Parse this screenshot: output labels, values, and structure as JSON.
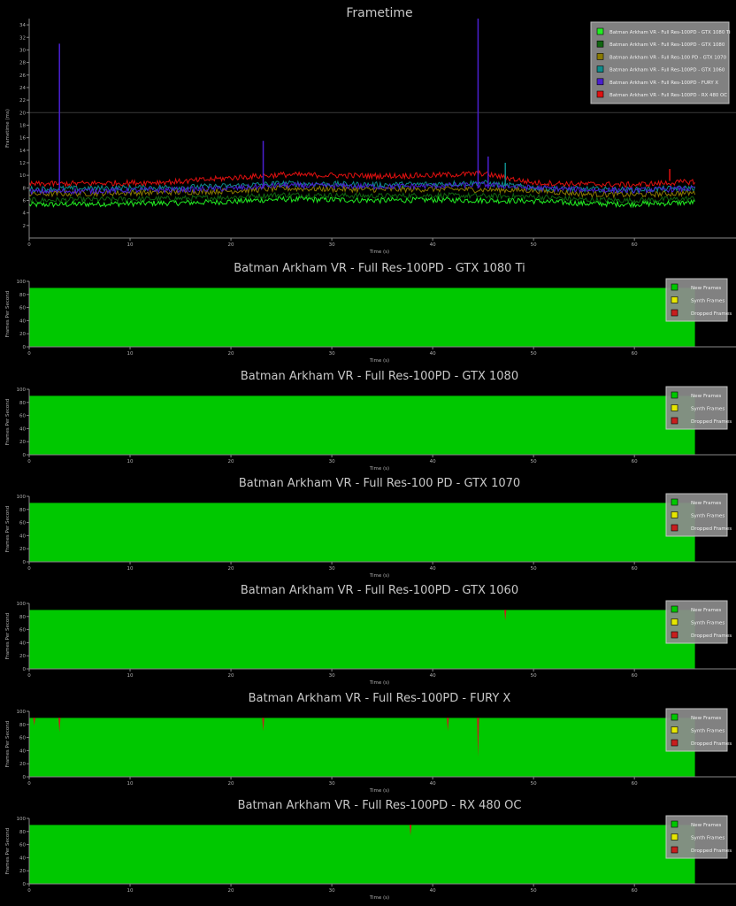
{
  "colors": {
    "background": "#000000",
    "axis": "#888888",
    "text": "#b0b0b0",
    "title": "#c8c8c8",
    "new_frames": "#00c800",
    "synth_frames": "#e6e600",
    "dropped_frames": "#c81e1e",
    "legend_bg": "#8c8c8c",
    "legend_border": "#d0d0d0"
  },
  "chart_data": [
    {
      "type": "line",
      "title": "Frametime",
      "xlabel": "Time (s)",
      "ylabel": "Frametime (ms)",
      "xlim": [
        0,
        70
      ],
      "ylim": [
        0,
        35
      ],
      "xticks": [
        0,
        10,
        20,
        30,
        40,
        50,
        60
      ],
      "yticks": [
        2,
        4,
        6,
        8,
        10,
        12,
        14,
        16,
        18,
        20,
        22,
        24,
        26,
        28,
        30,
        32,
        34
      ],
      "reference_line": 20,
      "grid": false,
      "legend_position": "top-right",
      "x": [
        0,
        5,
        10,
        15,
        20,
        25,
        30,
        35,
        40,
        45,
        50,
        55,
        60,
        66
      ],
      "series": [
        {
          "name": "Batman Arkham VR - Full Res-100PD - GTX 1080 Ti",
          "color": "#22ee22",
          "values": [
            5.3,
            5.4,
            5.5,
            5.6,
            5.8,
            6.2,
            6.1,
            6.0,
            6.1,
            6.0,
            5.9,
            5.5,
            5.4,
            5.7
          ]
        },
        {
          "name": "Batman Arkham VR - Full Res-100PD - GTX 1080",
          "color": "#116611",
          "values": [
            6.0,
            6.1,
            6.2,
            6.3,
            6.5,
            6.9,
            6.8,
            6.7,
            6.8,
            6.7,
            6.6,
            6.1,
            6.0,
            6.3
          ]
        },
        {
          "name": "Batman Arkham VR - Full Res-100 PD - GTX 1070",
          "color": "#8a7a00",
          "values": [
            7.0,
            7.1,
            7.2,
            7.3,
            7.5,
            7.9,
            7.8,
            7.7,
            7.8,
            7.7,
            7.6,
            7.0,
            6.9,
            7.2
          ]
        },
        {
          "name": "Batman Arkham VR - Full Res-100PD - GTX 1060",
          "color": "#0e8c8c",
          "values": [
            7.8,
            7.9,
            8.0,
            8.1,
            8.3,
            8.7,
            8.6,
            8.5,
            8.6,
            8.8,
            8.0,
            7.8,
            7.7,
            8.0
          ]
        },
        {
          "name": "Batman Arkham VR - Full Res-100PD - FURY X",
          "color": "#4a1fd0",
          "values": [
            7.4,
            7.5,
            7.6,
            7.7,
            7.9,
            8.4,
            8.3,
            8.2,
            8.3,
            8.5,
            8.0,
            7.7,
            7.6,
            7.9
          ]
        },
        {
          "name": "Batman Arkham VR - Full Res-100PD - RX 480 OC",
          "color": "#e01010",
          "values": [
            8.6,
            8.7,
            8.8,
            9.0,
            9.6,
            10.1,
            10.0,
            9.9,
            10.0,
            10.3,
            8.8,
            8.6,
            8.5,
            9.0
          ]
        }
      ],
      "spikes": [
        {
          "series": 4,
          "x": 3.0,
          "y": 31
        },
        {
          "series": 4,
          "x": 23.2,
          "y": 15.5
        },
        {
          "series": 4,
          "x": 44.5,
          "y": 35
        },
        {
          "series": 4,
          "x": 45.5,
          "y": 13
        },
        {
          "series": 3,
          "x": 47.2,
          "y": 12
        },
        {
          "series": 5,
          "x": 63.5,
          "y": 11
        }
      ]
    },
    {
      "type": "area",
      "title": "Batman Arkham VR - Full Res-100PD - GTX 1080 Ti",
      "xlabel": "Time (s)",
      "ylabel": "Frames Per Second",
      "xlim": [
        0,
        70
      ],
      "ylim": [
        0,
        100
      ],
      "xticks": [
        0,
        10,
        20,
        30,
        40,
        50,
        60
      ],
      "yticks": [
        0,
        20,
        40,
        60,
        80,
        100
      ],
      "end_time": 66.0,
      "fps": 90,
      "legend_position": "top-right",
      "legend": [
        "New Frames",
        "Synth Frames",
        "Dropped Frames"
      ],
      "dips": []
    },
    {
      "type": "area",
      "title": "Batman Arkham VR - Full Res-100PD - GTX 1080",
      "xlabel": "Time (s)",
      "ylabel": "Frames Per Second",
      "xlim": [
        0,
        70
      ],
      "ylim": [
        0,
        100
      ],
      "xticks": [
        0,
        10,
        20,
        30,
        40,
        50,
        60
      ],
      "yticks": [
        0,
        20,
        40,
        60,
        80,
        100
      ],
      "end_time": 66.0,
      "fps": 90,
      "legend_position": "top-right",
      "legend": [
        "New Frames",
        "Synth Frames",
        "Dropped Frames"
      ],
      "dips": []
    },
    {
      "type": "area",
      "title": "Batman Arkham VR - Full Res-100 PD - GTX 1070",
      "xlabel": "Time (s)",
      "ylabel": "Frames Per Second",
      "xlim": [
        0,
        70
      ],
      "ylim": [
        0,
        100
      ],
      "xticks": [
        0,
        10,
        20,
        30,
        40,
        50,
        60
      ],
      "yticks": [
        0,
        20,
        40,
        60,
        80,
        100
      ],
      "end_time": 66.0,
      "fps": 90,
      "legend_position": "top-right",
      "legend": [
        "New Frames",
        "Synth Frames",
        "Dropped Frames"
      ],
      "dips": []
    },
    {
      "type": "area",
      "title": "Batman Arkham VR - Full Res-100PD - GTX 1060",
      "xlabel": "Time (s)",
      "ylabel": "Frames Per Second",
      "xlim": [
        0,
        70
      ],
      "ylim": [
        0,
        100
      ],
      "xticks": [
        0,
        10,
        20,
        30,
        40,
        50,
        60
      ],
      "yticks": [
        0,
        20,
        40,
        60,
        80,
        100
      ],
      "end_time": 66.0,
      "fps": 90,
      "legend_position": "top-right",
      "legend": [
        "New Frames",
        "Synth Frames",
        "Dropped Frames"
      ],
      "dips": [
        {
          "x": 47.2,
          "y": 74
        }
      ]
    },
    {
      "type": "area",
      "title": "Batman Arkham VR - Full Res-100PD - FURY X",
      "xlabel": "Time (s)",
      "ylabel": "Frames Per Second",
      "xlim": [
        0,
        70
      ],
      "ylim": [
        0,
        100
      ],
      "xticks": [
        0,
        10,
        20,
        30,
        40,
        50,
        60
      ],
      "yticks": [
        0,
        20,
        40,
        60,
        80,
        100
      ],
      "end_time": 66.0,
      "fps": 90,
      "legend_position": "top-right",
      "legend": [
        "New Frames",
        "Synth Frames",
        "Dropped Frames"
      ],
      "dips": [
        {
          "x": 0.5,
          "y": 78
        },
        {
          "x": 3.0,
          "y": 68
        },
        {
          "x": 23.2,
          "y": 70
        },
        {
          "x": 41.5,
          "y": 70
        },
        {
          "x": 44.5,
          "y": 30
        }
      ]
    },
    {
      "type": "area",
      "title": "Batman Arkham VR - Full Res-100PD - RX 480 OC",
      "xlabel": "Time (s)",
      "ylabel": "Frames Per Second",
      "xlim": [
        0,
        70
      ],
      "ylim": [
        0,
        100
      ],
      "xticks": [
        0,
        10,
        20,
        30,
        40,
        50,
        60
      ],
      "yticks": [
        0,
        20,
        40,
        60,
        80,
        100
      ],
      "end_time": 66.0,
      "fps": 90,
      "legend_position": "top-right",
      "legend": [
        "New Frames",
        "Synth Frames",
        "Dropped Frames"
      ],
      "dips": [
        {
          "x": 37.8,
          "y": 74
        }
      ]
    }
  ]
}
